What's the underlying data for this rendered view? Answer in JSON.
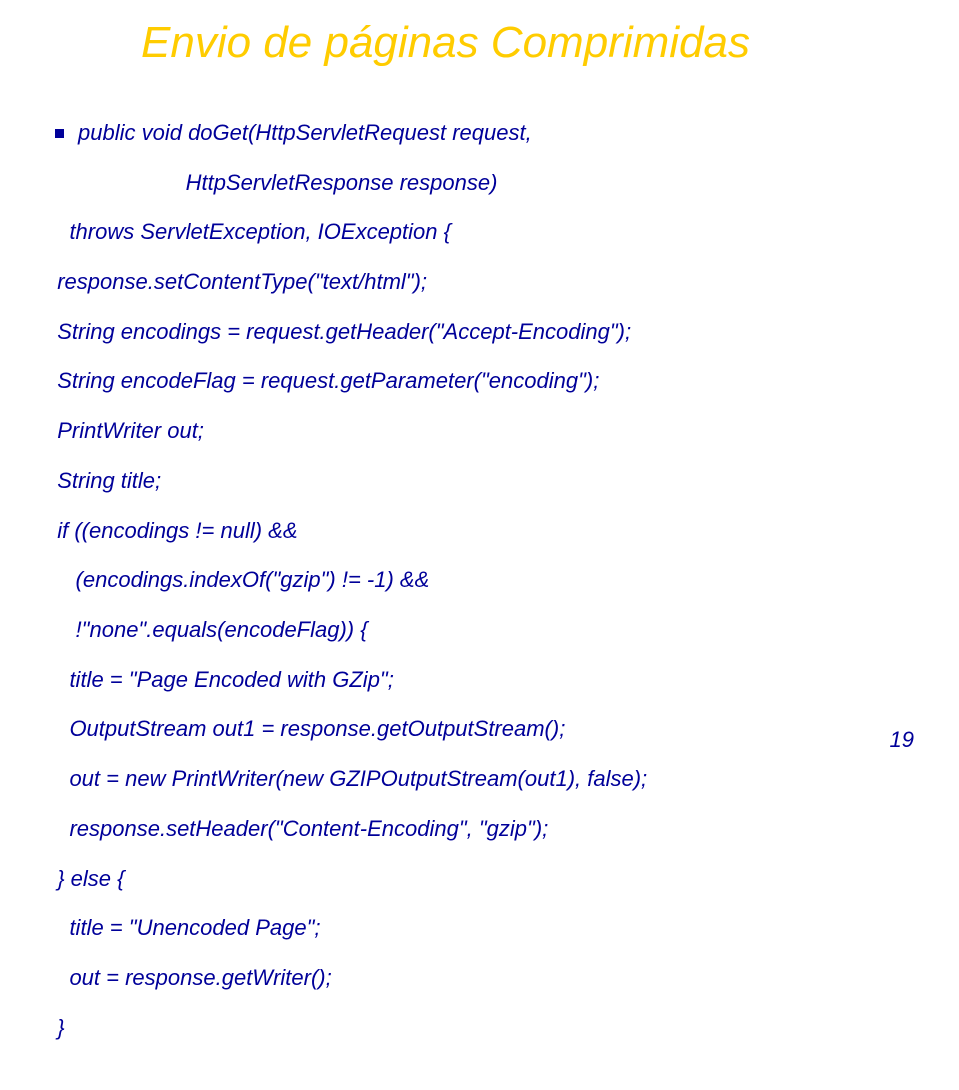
{
  "title": "Envio de páginas Comprimidas",
  "code": {
    "l0": "public void doGet(HttpServletRequest request,",
    "l1": "                       HttpServletResponse response)",
    "l2": "    throws ServletException, IOException {",
    "l3": "  response.setContentType(\"text/html\");",
    "l4": "  String encodings = request.getHeader(\"Accept-Encoding\");",
    "l5": "  String encodeFlag = request.getParameter(\"encoding\");",
    "l6": "  PrintWriter out;",
    "l7": "  String title;",
    "l8": "  if ((encodings != null) &&",
    "l9": "     (encodings.indexOf(\"gzip\") != -1) &&",
    "l10": "     !\"none\".equals(encodeFlag)) {",
    "l11": "    title = \"Page Encoded with GZip\";",
    "l12": "    OutputStream out1 = response.getOutputStream();",
    "l13": "    out = new PrintWriter(new GZIPOutputStream(out1), false);",
    "l14": "    response.setHeader(\"Content-Encoding\", \"gzip\");",
    "l15": "  } else {",
    "l16": "    title = \"Unencoded Page\";",
    "l17": "    out = response.getWriter();",
    "l18": "  }"
  },
  "pageNumber": "19"
}
